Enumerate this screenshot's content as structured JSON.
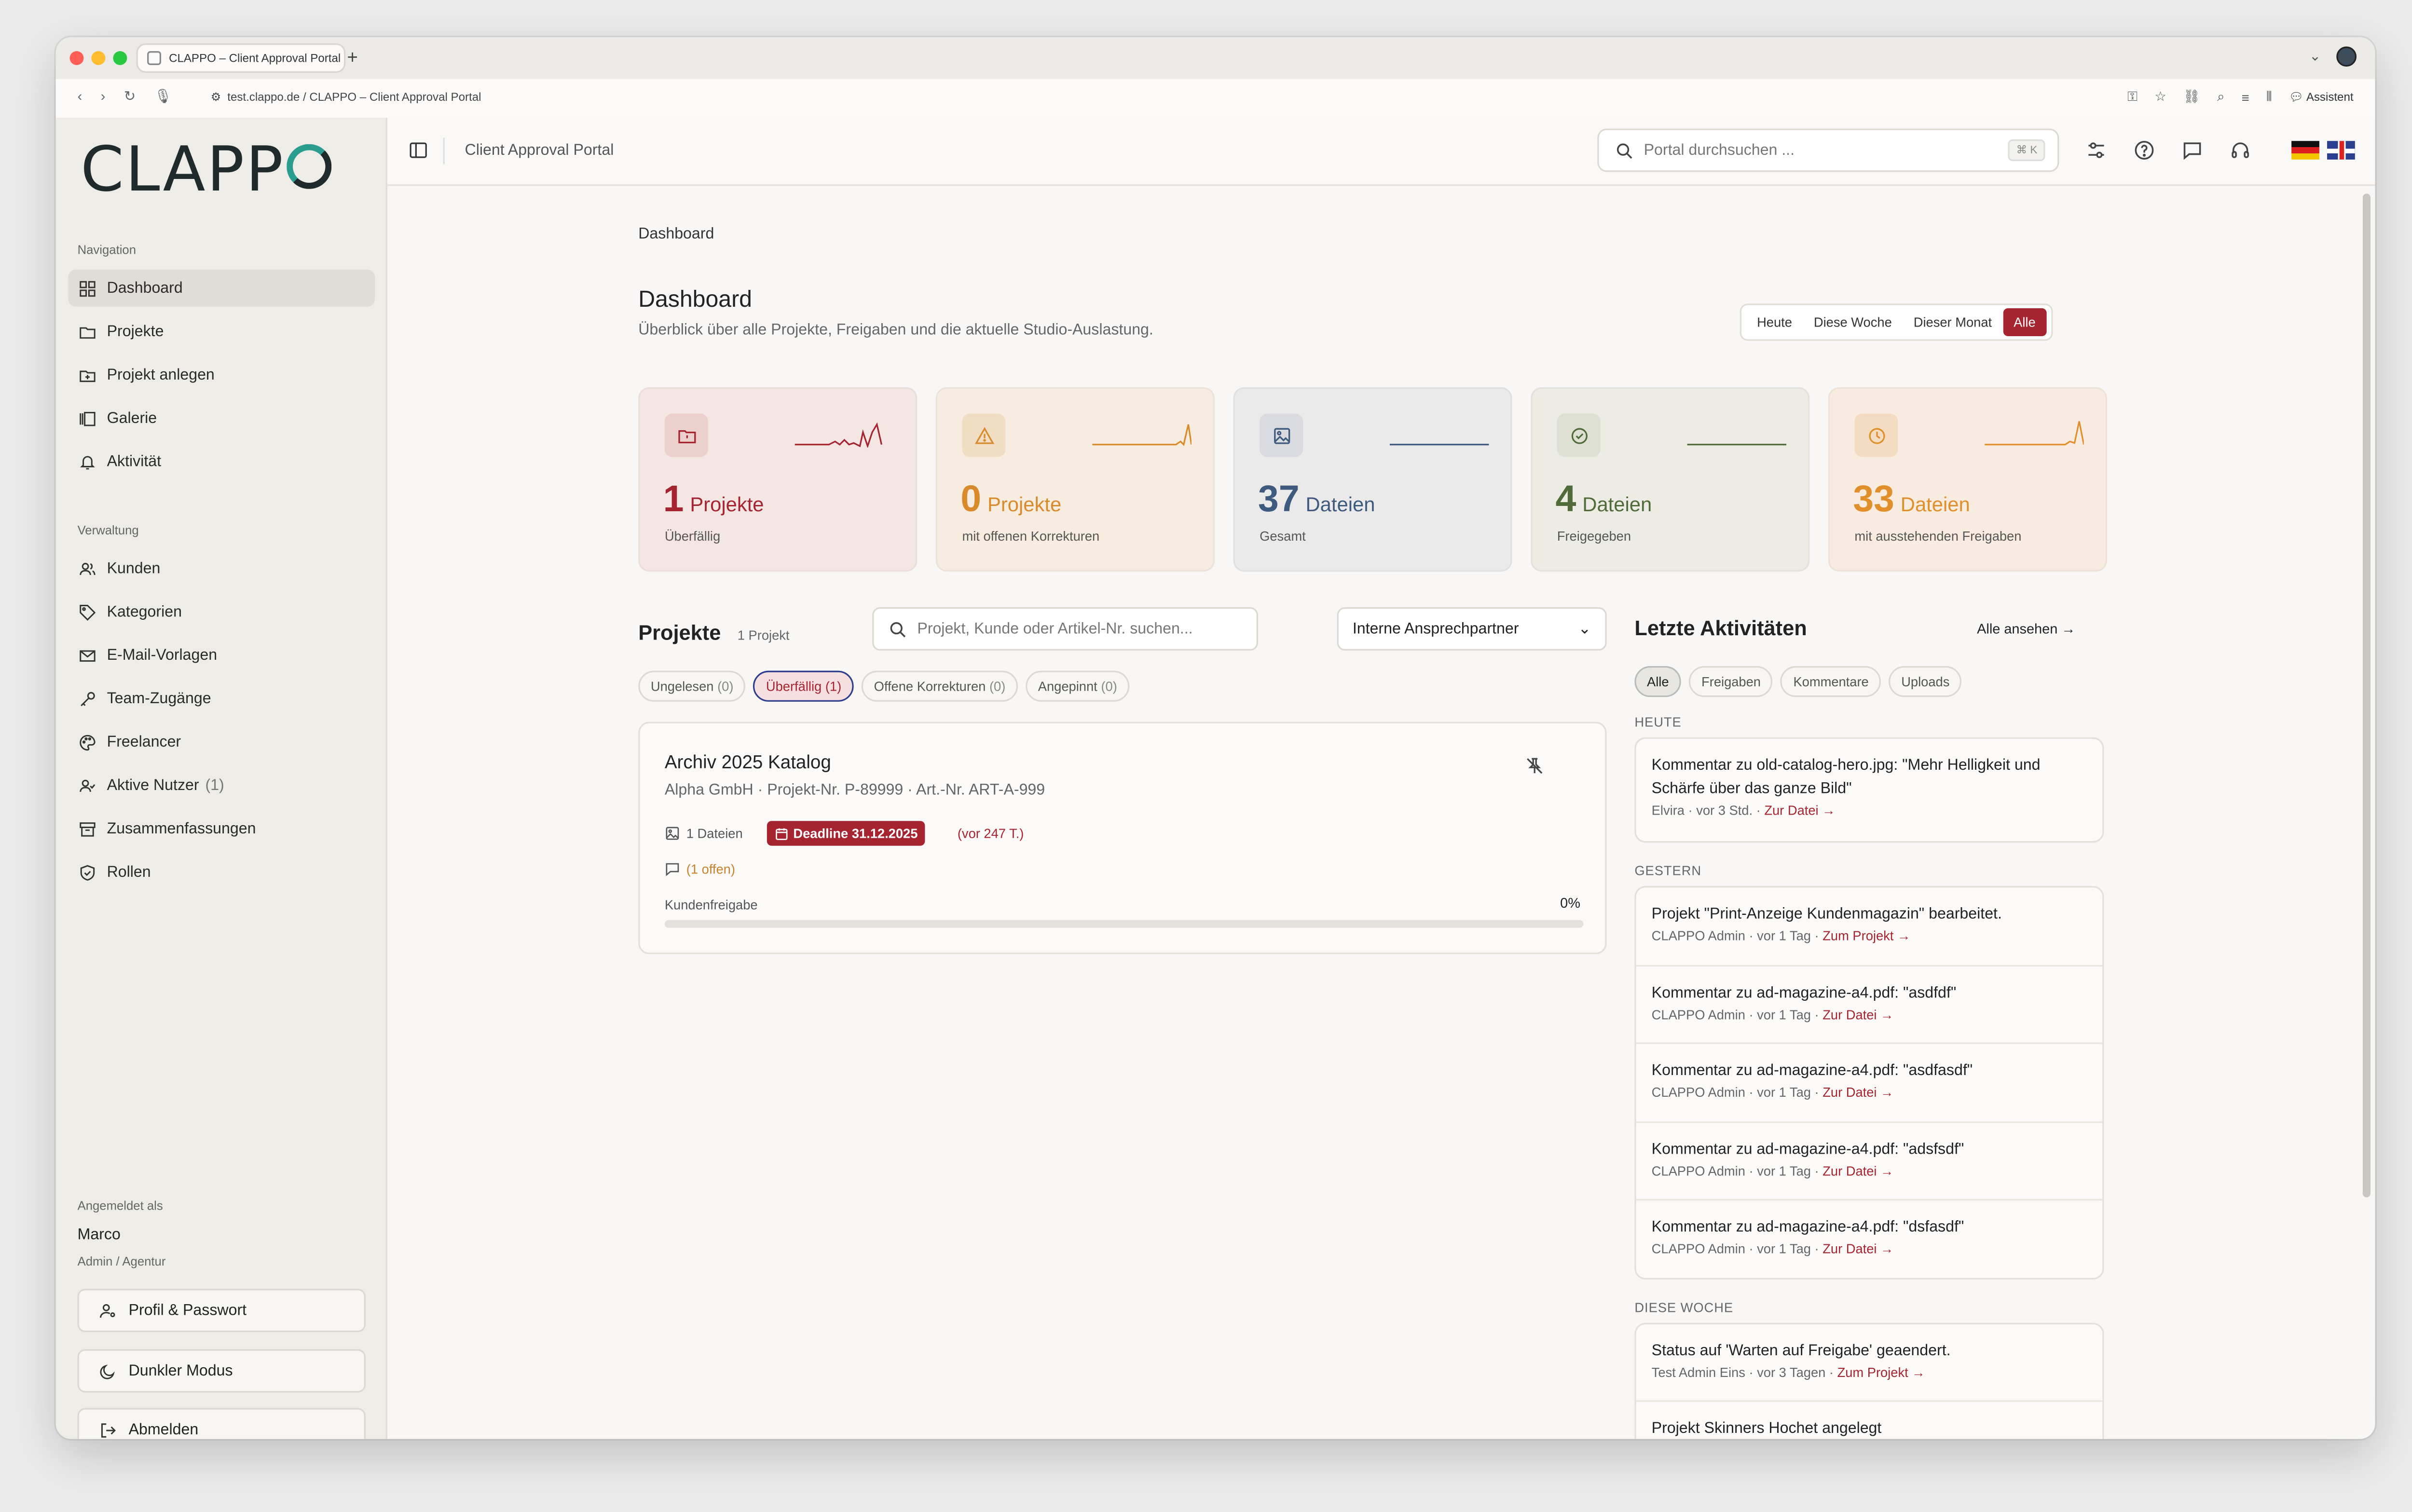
{
  "browser": {
    "tab_title": "CLAPPO – Client Approval Portal",
    "new_tab_glyph": "+",
    "url": "test.clappo.de / CLAPPO – Client Approval Portal",
    "assistant_label": "Assistent"
  },
  "sidebar": {
    "logo_text": "CLAPPO",
    "navigation_label": "Navigation",
    "nav_items": [
      {
        "label": "Dashboard",
        "icon": "grid-icon"
      },
      {
        "label": "Projekte",
        "icon": "folder-icon"
      },
      {
        "label": "Projekt anlegen",
        "icon": "folder-plus-icon"
      },
      {
        "label": "Galerie",
        "icon": "gallery-icon"
      },
      {
        "label": "Aktivität",
        "icon": "bell-icon"
      }
    ],
    "admin_label": "Verwaltung",
    "admin_items": [
      {
        "label": "Kunden",
        "icon": "users-icon"
      },
      {
        "label": "Kategorien",
        "icon": "tag-icon"
      },
      {
        "label": "E-Mail-Vorlagen",
        "icon": "mail-icon"
      },
      {
        "label": "Team-Zugänge",
        "icon": "key-icon"
      },
      {
        "label": "Freelancer",
        "icon": "palette-icon"
      },
      {
        "label": "Aktive Nutzer",
        "count": "(1)",
        "icon": "user-active-icon"
      },
      {
        "label": "Zusammenfassungen",
        "icon": "archive-icon"
      },
      {
        "label": "Rollen",
        "icon": "shield-icon"
      }
    ],
    "logged_in_label": "Angemeldet als",
    "user_name": "Marco",
    "user_role": "Admin / Agentur",
    "profile_button": "Profil & Passwort",
    "dark_mode_button": "Dunkler Modus",
    "logout_button": "Abmelden"
  },
  "topbar": {
    "title": "Client Approval Portal",
    "search_placeholder": "Portal durchsuchen ...",
    "search_shortcut": "⌘ K"
  },
  "dashboard": {
    "breadcrumb": "Dashboard",
    "title": "Dashboard",
    "subtitle": "Überblick über alle Projekte, Freigaben und die aktuelle Studio-Auslastung.",
    "ranges": [
      "Heute",
      "Diese Woche",
      "Dieser Monat",
      "Alle"
    ],
    "active_range": "Alle",
    "stats": [
      {
        "value": "1",
        "unit": "Projekte",
        "label": "Überfällig",
        "color": "#a6242f",
        "bg": "#f4e6e3",
        "icon": "folder-alert-icon"
      },
      {
        "value": "0",
        "unit": "Projekte",
        "label": "mit offenen Korrekturen",
        "color": "#d98b2b",
        "bg": "#f7ece0",
        "icon": "warning-icon"
      },
      {
        "value": "37",
        "unit": "Dateien",
        "label": "Gesamt",
        "color": "#3e5a7e",
        "bg": "#eaeaea",
        "icon": "image-icon"
      },
      {
        "value": "4",
        "unit": "Dateien",
        "label": "Freigegeben",
        "color": "#4f6b3a",
        "bg": "#ecebe4",
        "icon": "check-circle-icon"
      },
      {
        "value": "33",
        "unit": "Dateien",
        "label": "mit ausstehenden Freigaben",
        "color": "#e08f2a",
        "bg": "#f8ece0",
        "icon": "clock-icon"
      }
    ]
  },
  "projects": {
    "heading": "Projekte",
    "count": "1 Projekt",
    "search_placeholder": "Projekt, Kunde oder Artikel-Nr. suchen...",
    "contact_select": "Interne Ansprechpartner",
    "filters": [
      {
        "label": "Ungelesen",
        "count": "(0)"
      },
      {
        "label": "Überfällig",
        "count": "(1)"
      },
      {
        "label": "Offene Korrekturen",
        "count": "(0)"
      },
      {
        "label": "Angepinnt",
        "count": "(0)"
      }
    ],
    "items": [
      {
        "title": "Archiv 2025 Katalog",
        "meta": "Alpha GmbH · Projekt-Nr. P-89999 · Art.-Nr. ART-A-999",
        "files": "1 Dateien",
        "deadline": "Deadline 31.12.2025",
        "overdue": "(vor 247 T.)",
        "comments": "(1 offen)",
        "approval_label": "Kundenfreigabe",
        "approval_percent": "0%",
        "approval_value": 0
      }
    ]
  },
  "activity": {
    "heading": "Letzte Aktivitäten",
    "see_all": "Alle ansehen",
    "filters": [
      "Alle",
      "Freigaben",
      "Kommentare",
      "Uploads"
    ],
    "groups": [
      {
        "label": "HEUTE",
        "items": [
          {
            "text": "Kommentar zu old-catalog-hero.jpg: \"Mehr Helligkeit und Schärfe über das ganze Bild\"",
            "meta": "Elvira · vor 3 Std. · ",
            "link": "Zur Datei →"
          }
        ]
      },
      {
        "label": "GESTERN",
        "items": [
          {
            "text": "Projekt \"Print-Anzeige Kundenmagazin\" bearbeitet.",
            "meta": "CLAPPO Admin · vor 1 Tag · ",
            "link": "Zum Projekt →"
          },
          {
            "text": "Kommentar zu ad-magazine-a4.pdf: \"asdfdf\"",
            "meta": "CLAPPO Admin · vor 1 Tag · ",
            "link": "Zur Datei →"
          },
          {
            "text": "Kommentar zu ad-magazine-a4.pdf: \"asdfasdf\"",
            "meta": "CLAPPO Admin · vor 1 Tag · ",
            "link": "Zur Datei →"
          },
          {
            "text": "Kommentar zu ad-magazine-a4.pdf: \"adsfsdf\"",
            "meta": "CLAPPO Admin · vor 1 Tag · ",
            "link": "Zur Datei →"
          },
          {
            "text": "Kommentar zu ad-magazine-a4.pdf: \"dsfasdf\"",
            "meta": "CLAPPO Admin · vor 1 Tag · ",
            "link": "Zur Datei →"
          }
        ]
      },
      {
        "label": "DIESE WOCHE",
        "items": [
          {
            "text": "Status auf 'Warten auf Freigabe' geaendert.",
            "meta": "Test Admin Eins · vor 3 Tagen · ",
            "link": "Zum Projekt →"
          },
          {
            "text": "Projekt Skinners Hochet angelegt",
            "meta": "",
            "link": ""
          }
        ]
      }
    ]
  },
  "colors": {
    "accent": "#a6242f",
    "teal": "#2a9d8f"
  }
}
